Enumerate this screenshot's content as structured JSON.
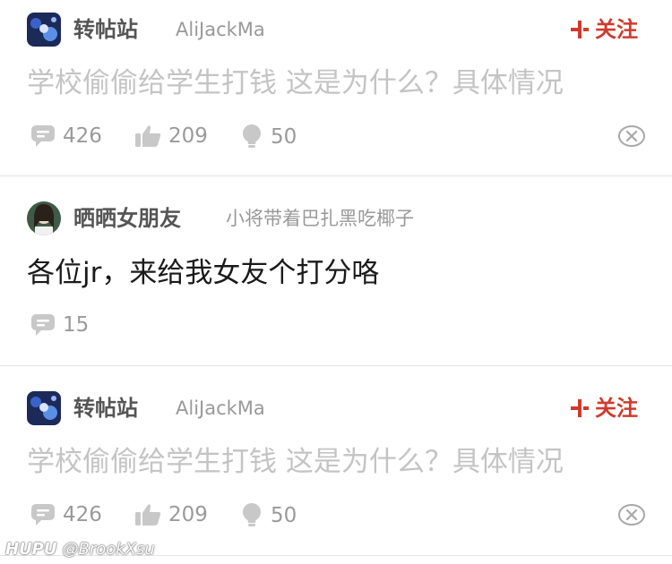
{
  "posts": [
    {
      "board": "转帖站",
      "author": "AliJackMa",
      "follow_label": "关注",
      "title": "学校偷偷给学生打钱 这是为什么？具体情况",
      "replies": "426",
      "likes": "209",
      "lights": "50"
    },
    {
      "board": "晒晒女朋友",
      "author": "小将带着巴扎黑吃椰子",
      "title": "各位jr，来给我女友个打分咯",
      "replies": "15"
    },
    {
      "board": "转帖站",
      "author": "AliJackMa",
      "follow_label": "关注",
      "title": "学校偷偷给学生打钱 这是为什么？具体情况",
      "replies": "426",
      "likes": "209",
      "lights": "50"
    }
  ],
  "watermark": {
    "brand": "HUPU",
    "user": "@BrookXsu"
  },
  "colors": {
    "accent": "#d03a2e",
    "muted_text": "#c4c4c4",
    "meta_text": "#999999"
  }
}
